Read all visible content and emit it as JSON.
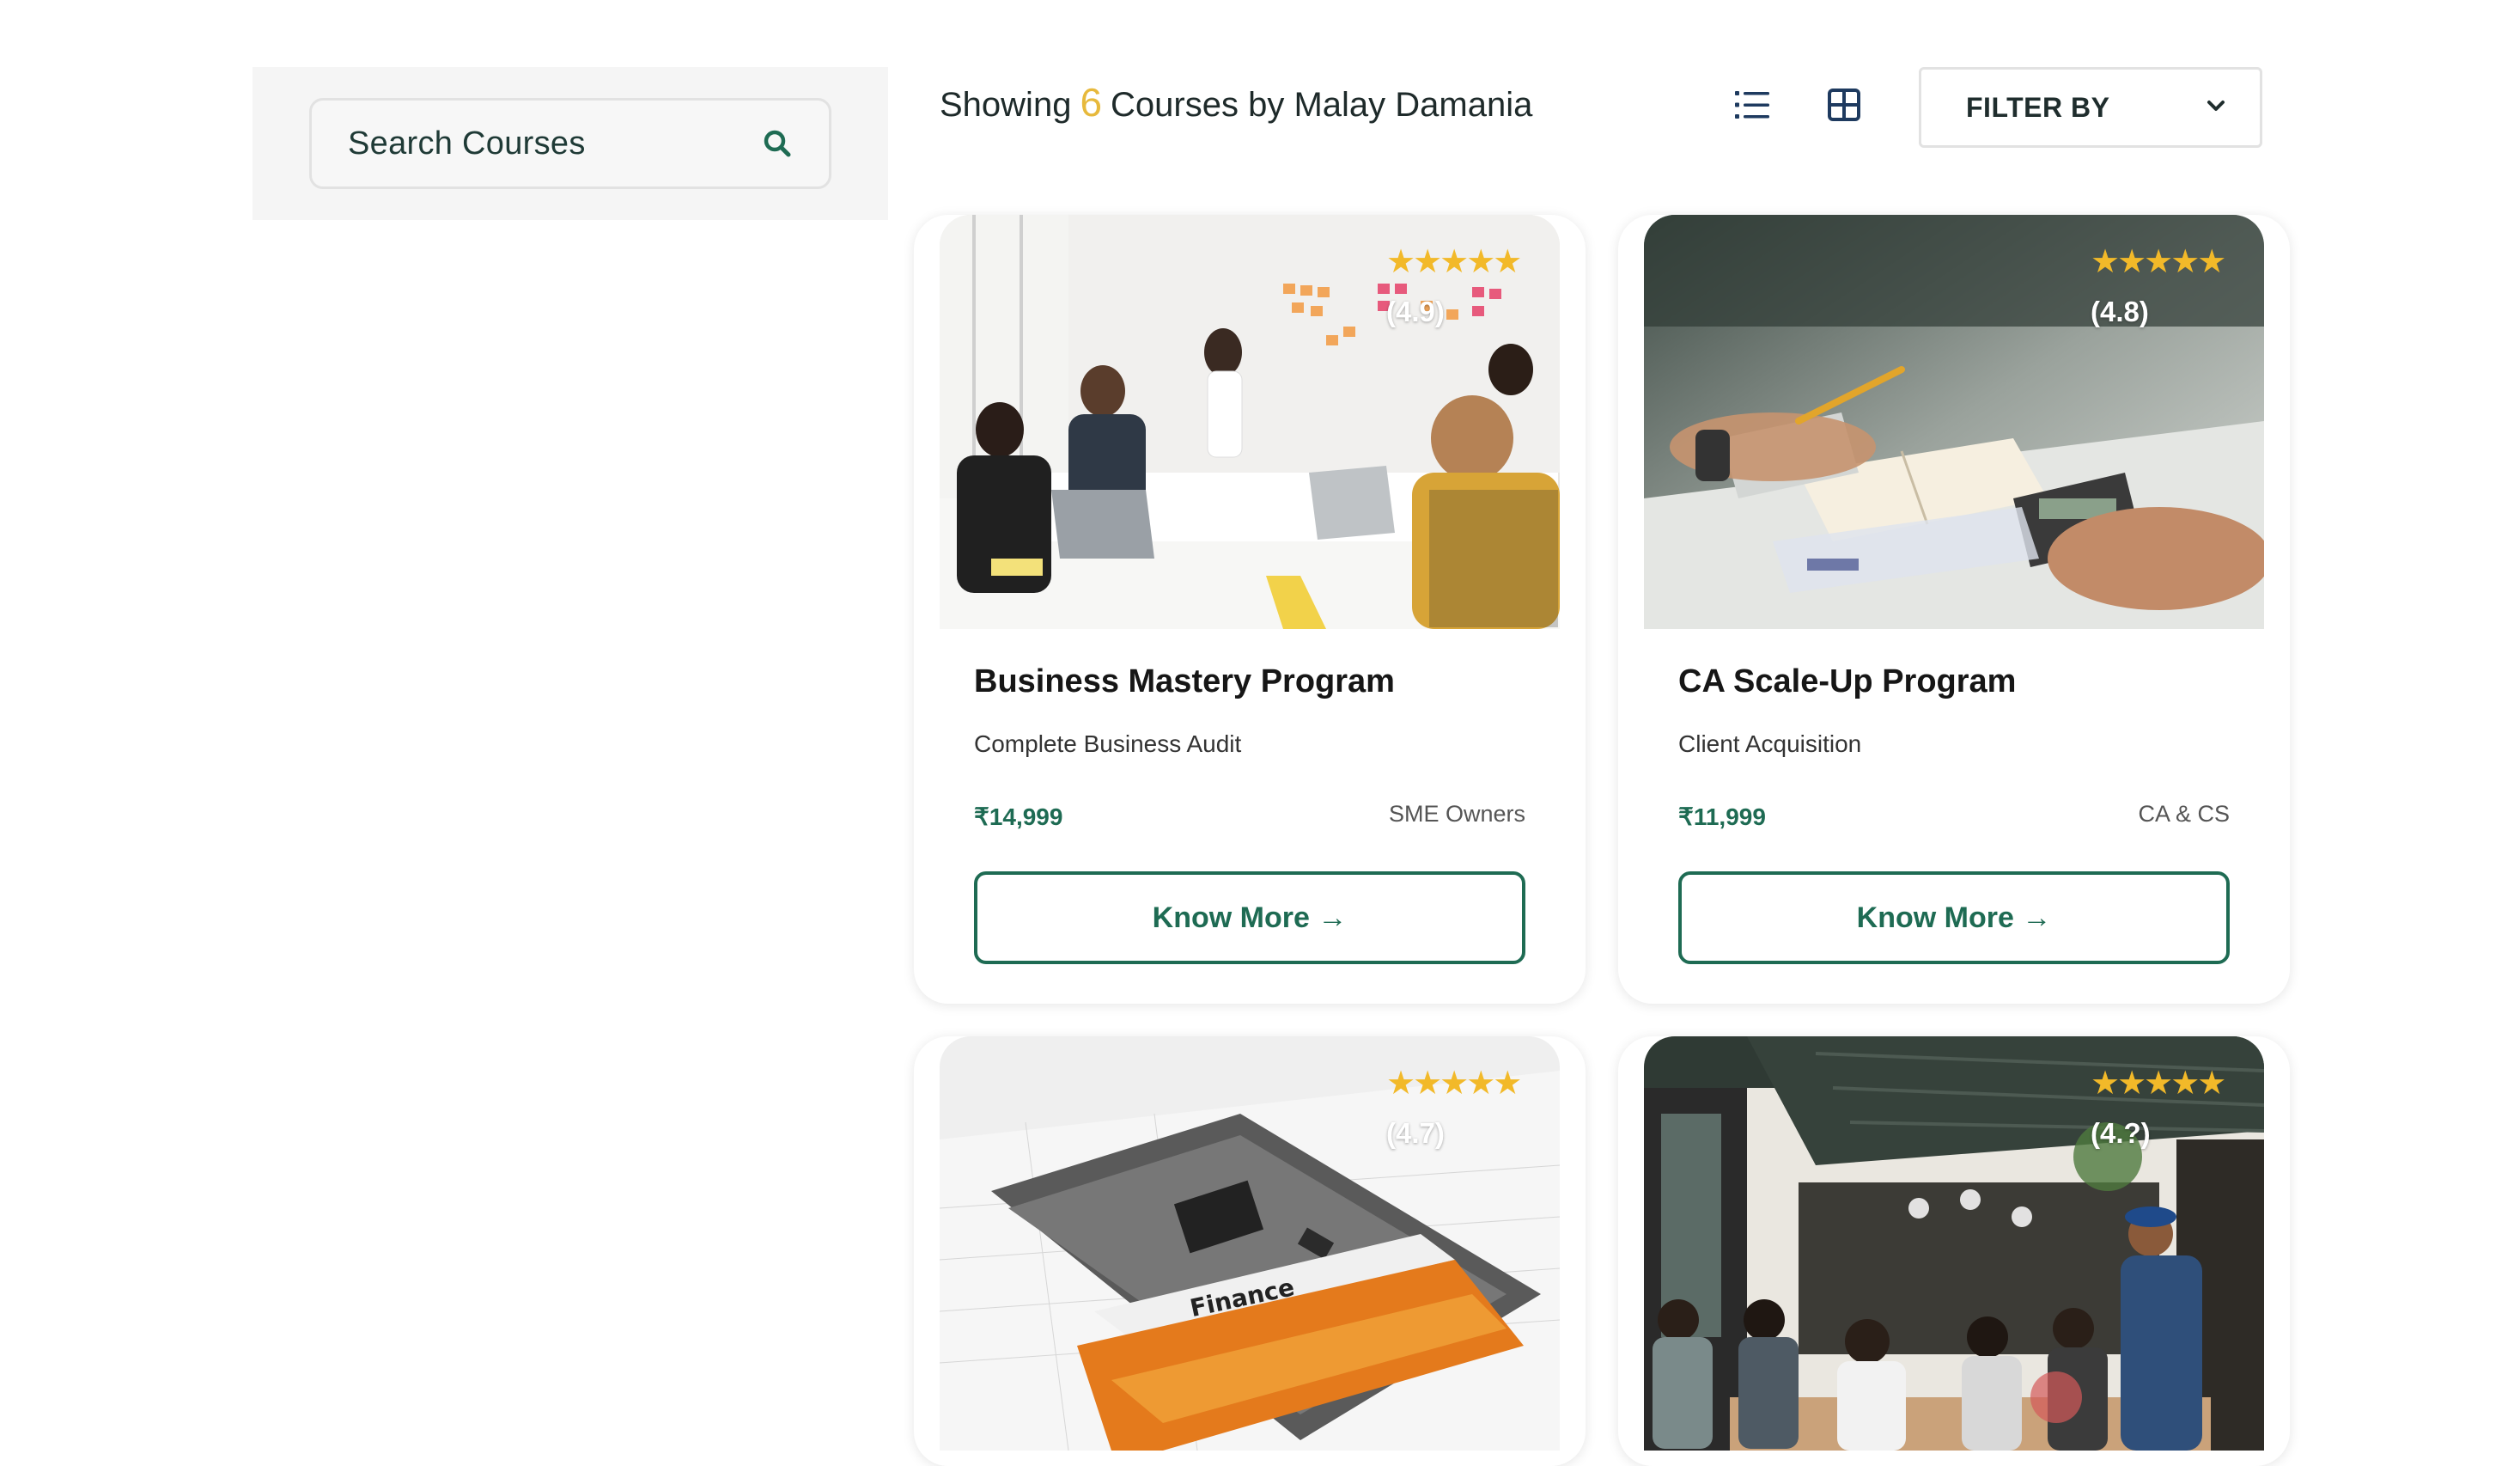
{
  "search": {
    "placeholder": "Search Courses"
  },
  "header": {
    "prefix": "Showing",
    "count": "6",
    "suffix": "Courses by Malay Damania"
  },
  "view_toggle": {
    "list_icon": "list-view-icon",
    "grid_icon": "grid-view-icon"
  },
  "filter": {
    "label": "FILTER BY",
    "icon": "chevron-down-icon"
  },
  "colors": {
    "accent_green": "#1e6b53",
    "star_gold": "#f2b929",
    "count_gold": "#e7b93c"
  },
  "courses": [
    {
      "rating_stars": "★★★★★",
      "rating": "(4.9)",
      "title": "Business Mastery Program",
      "subtitle": "Complete Business Audit",
      "price": "₹14,999",
      "audience": "SME Owners",
      "cta": "Know More →",
      "image": "office-meeting-photo"
    },
    {
      "rating_stars": "★★★★★",
      "rating": "(4.8)",
      "title": "CA Scale-Up Program",
      "subtitle": "Client Acquisition",
      "price": "₹11,999",
      "audience": "CA & CS",
      "cta": "Know More →",
      "image": "calculator-notes-photo"
    },
    {
      "rating_stars": "★★★★★",
      "rating": "(4.7)",
      "image": "finance-calculator-photo"
    },
    {
      "rating_stars": "★★★★★",
      "rating": "(4.?)",
      "image": "restaurant-team-photo"
    }
  ]
}
